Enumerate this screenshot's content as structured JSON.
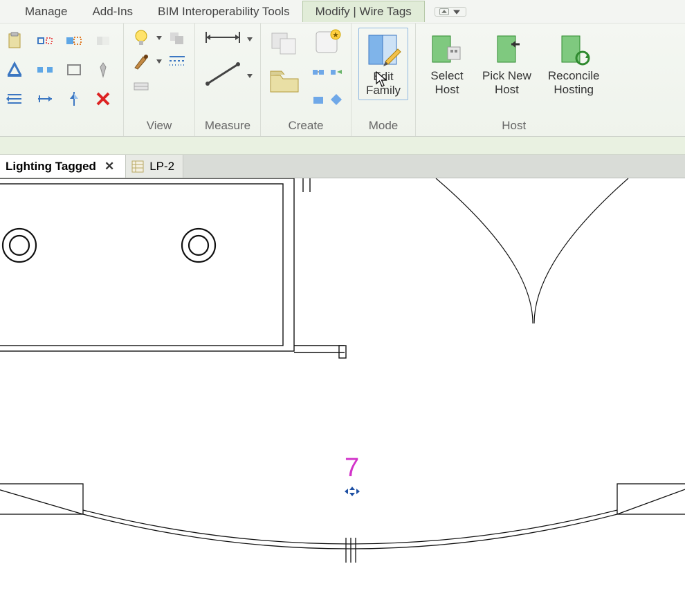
{
  "menu": {
    "items": [
      "Manage",
      "Add-Ins",
      "BIM Interoperability Tools",
      "Modify | Wire Tags"
    ],
    "active_index": 3
  },
  "ribbon": {
    "panels": [
      {
        "name": "view",
        "label": "View"
      },
      {
        "name": "measure",
        "label": "Measure"
      },
      {
        "name": "create",
        "label": "Create"
      },
      {
        "name": "mode",
        "label": "Mode",
        "buttons": [
          {
            "id": "edit-family",
            "line1": "Edit",
            "line2": "Family",
            "selected": true
          }
        ]
      },
      {
        "name": "host",
        "label": "Host",
        "buttons": [
          {
            "id": "select-host",
            "line1": "Select",
            "line2": "Host"
          },
          {
            "id": "pick-new-host",
            "line1": "Pick New",
            "line2": "Host"
          },
          {
            "id": "reconcile-hosting",
            "line1": "Reconcile",
            "line2": "Hosting"
          }
        ]
      }
    ]
  },
  "tabs": {
    "items": [
      {
        "id": "lighting-tagged",
        "label": "Lighting Tagged",
        "active": true,
        "closeable": true
      },
      {
        "id": "lp-2",
        "label": "LP-2",
        "active": false,
        "closeable": false
      }
    ]
  },
  "canvas": {
    "wire_tag_value": "7"
  }
}
